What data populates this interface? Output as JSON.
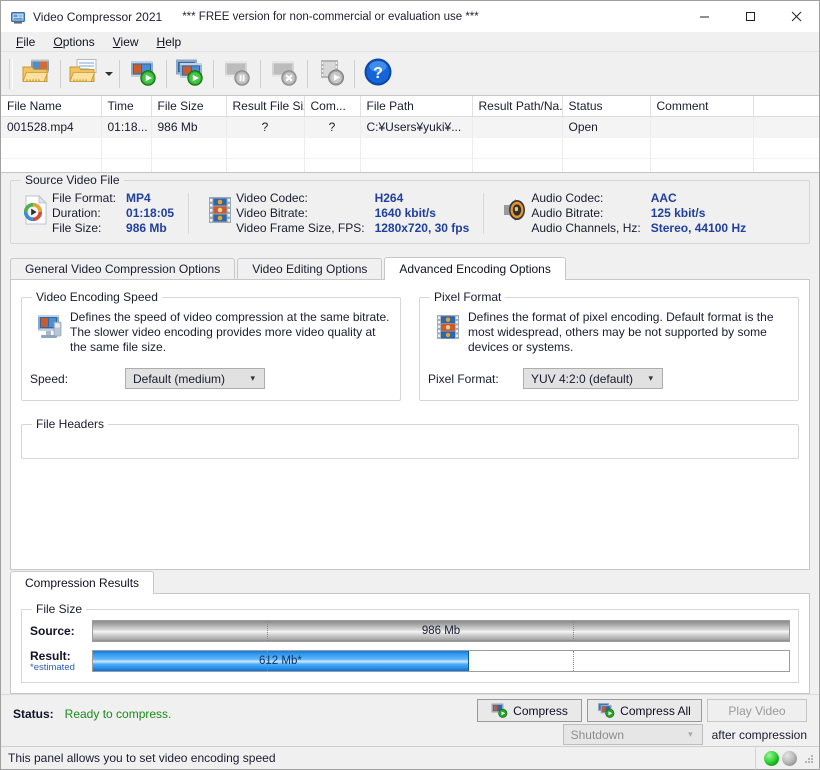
{
  "window": {
    "icon": "app-video-icon",
    "title": "Video Compressor 2021",
    "subtitle": "*** FREE version for non-commercial or evaluation use ***",
    "minimize": "–",
    "maximize": "☐",
    "close": "✕"
  },
  "menu": [
    {
      "label": "File",
      "accel": "F"
    },
    {
      "label": "Options",
      "accel": "O"
    },
    {
      "label": "View",
      "accel": "V"
    },
    {
      "label": "Help",
      "accel": "H"
    }
  ],
  "toolbar": [
    {
      "name": "add-video-files-button",
      "icon": "open-video-folder-icon",
      "enabled": true
    },
    {
      "name": "add-video-folder-button",
      "icon": "open-folder-dropdown-icon",
      "enabled": true,
      "dropdown": true
    },
    {
      "name": "compress-button",
      "icon": "compress-play-icon",
      "enabled": true
    },
    {
      "name": "compress-all-button",
      "icon": "compress-all-play-icon",
      "enabled": true
    },
    {
      "name": "pause-button",
      "icon": "pause-icon",
      "enabled": false
    },
    {
      "name": "stop-button",
      "icon": "stop-cancel-icon",
      "enabled": false
    },
    {
      "name": "play-video-button",
      "icon": "film-play-icon",
      "enabled": false
    },
    {
      "name": "help-button",
      "icon": "help-question-icon",
      "enabled": true
    }
  ],
  "filelist": {
    "columns": [
      "File Name",
      "Time",
      "File Size",
      "Result File Size",
      "Com...",
      "File Path",
      "Result Path/Na...",
      "Status",
      "Comment",
      ""
    ],
    "rows": [
      {
        "file_name": "001528.mp4",
        "time": "01:18...",
        "file_size": "986 Mb",
        "result_file_size": "?",
        "com": "?",
        "file_path": "C:¥Users¥yuki¥...",
        "result_path": "",
        "status": "Open",
        "comment": "",
        "extra": ""
      }
    ],
    "empty_rows": 2
  },
  "source_video": {
    "legend": "Source Video File",
    "file_icon": "media-player-file-icon",
    "video_icon": "film-strip-icon",
    "audio_icon": "speaker-icon",
    "file": [
      {
        "key": "File Format:",
        "value": "MP4"
      },
      {
        "key": "Duration:",
        "value": "01:18:05"
      },
      {
        "key": "File Size:",
        "value": "986 Mb"
      }
    ],
    "video": [
      {
        "key": "Video Codec:",
        "value": "H264"
      },
      {
        "key": "Video Bitrate:",
        "value": "1640 kbit/s"
      },
      {
        "key": "Video Frame Size, FPS:",
        "value": "1280x720, 30 fps"
      }
    ],
    "audio": [
      {
        "key": "Audio Codec:",
        "value": "AAC"
      },
      {
        "key": "Audio Bitrate:",
        "value": "125 kbit/s"
      },
      {
        "key": "Audio Channels, Hz:",
        "value": "Stereo, 44100 Hz"
      }
    ]
  },
  "tabs": [
    {
      "label": "General Video Compression Options",
      "active": false
    },
    {
      "label": "Video Editing Options",
      "active": false
    },
    {
      "label": "Advanced Encoding Options",
      "active": true
    }
  ],
  "encoding_speed": {
    "legend": "Video Encoding Speed",
    "icon": "encoding-speed-icon",
    "description": "Defines the speed of video compression at the same bitrate. The slower video encoding provides more video quality at the same file size.",
    "field_label": "Speed:",
    "value": "Default (medium)",
    "options": [
      "Default (medium)"
    ]
  },
  "pixel_format": {
    "legend": "Pixel Format",
    "icon": "pixel-format-icon",
    "description": "Defines the format of pixel encoding. Default format is the most widespread, others may be not supported by some devices or systems.",
    "field_label": "Pixel Format:",
    "value": "YUV 4:2:0 (default)",
    "options": [
      "YUV 4:2:0 (default)"
    ]
  },
  "file_headers": {
    "legend": "File Headers",
    "value": ""
  },
  "results": {
    "tab_label": "Compression Results",
    "legend": "File Size",
    "source_label": "Source:",
    "source_value": "986 Mb",
    "source_percent": 100,
    "result_label": "Result:",
    "result_note": "*estimated",
    "result_value": "612 Mb*",
    "result_percent": 54,
    "tick_percents": [
      25,
      69
    ]
  },
  "actions": {
    "status_label": "Status:",
    "status_value": "Ready to compress.",
    "status_color": "#1a8a1a",
    "compress": "Compress",
    "compress_icon": "compress-play-icon",
    "compress_all": "Compress All",
    "compress_all_icon": "compress-all-play-icon",
    "play_video": "Play Video",
    "play_video_enabled": false,
    "after_action": "Shutdown",
    "after_action_suffix": "after compression"
  },
  "statusbar": {
    "hint": "This panel allows you to set video encoding speed",
    "lamp_active": "green-lamp",
    "lamp_idle": "grey-lamp"
  }
}
